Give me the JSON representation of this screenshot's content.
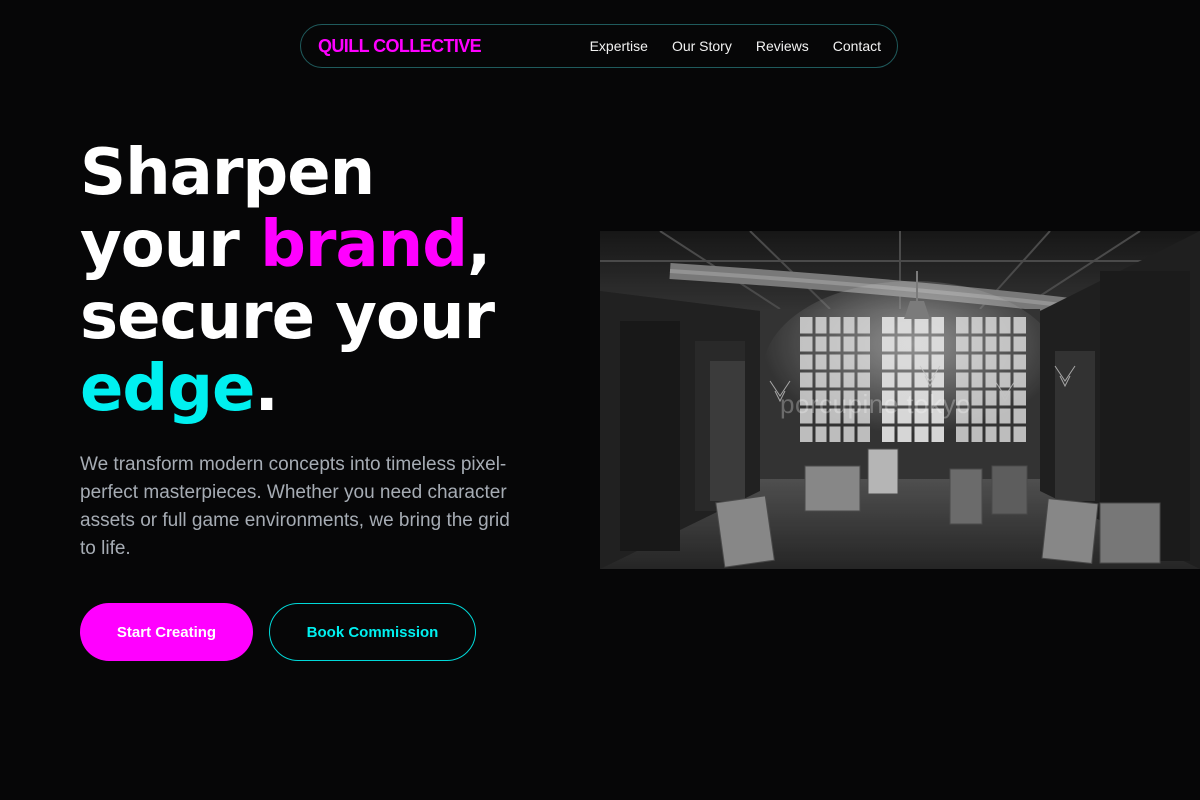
{
  "nav": {
    "brand": "QUILL COLLECTIVE",
    "links": [
      "Expertise",
      "Our Story",
      "Reviews",
      "Contact"
    ]
  },
  "hero": {
    "headline": {
      "line1": "Sharpen",
      "line2_start": "your ",
      "line2_accent": "brand",
      "line2_end": ",",
      "line3": "secure your",
      "line4_accent": "edge",
      "line4_end": "."
    },
    "subtext": "We transform modern concepts into timeless pixel-perfect masterpieces. Whether you need character assets or full game environments, we bring the grid to life.",
    "primary_button": "Start Creating",
    "secondary_button": "Book Commission"
  },
  "image": {
    "watermark": "porcupine tokyo"
  },
  "colors": {
    "background": "#060607",
    "magenta": "#ff00ff",
    "cyan": "#00f0f0",
    "nav_border": "#1f5a5c",
    "subtext": "#a6acb4"
  }
}
